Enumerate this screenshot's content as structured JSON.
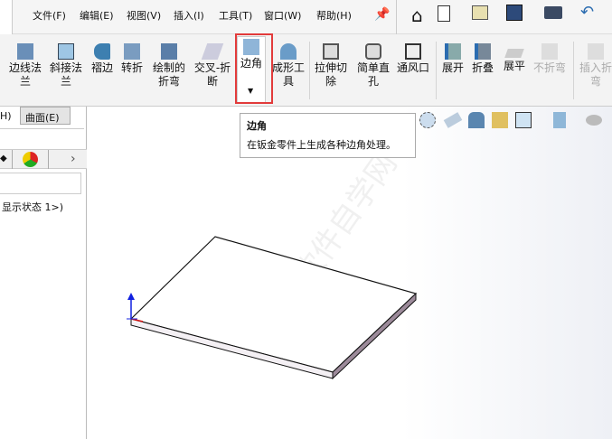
{
  "menu": [
    "文件(F)",
    "编辑(E)",
    "视图(V)",
    "插入(I)",
    "工具(T)",
    "窗口(W)",
    "帮助(H)"
  ],
  "ribbon": [
    {
      "label": "边线法\n兰",
      "enabled": true
    },
    {
      "label": "斜接法\n兰",
      "enabled": true
    },
    {
      "label": "褶边",
      "enabled": true
    },
    {
      "label": "转折",
      "enabled": true
    },
    {
      "label": "绘制的\n折弯",
      "enabled": true
    },
    {
      "label": "交叉-折\n断",
      "enabled": true
    },
    {
      "label": "边角",
      "enabled": true
    },
    {
      "label": "成形工\n具",
      "enabled": true
    },
    {
      "label": "拉伸切\n除",
      "enabled": true
    },
    {
      "label": "简单直\n孔",
      "enabled": true
    },
    {
      "label": "通风口",
      "enabled": true
    },
    {
      "label": "展开",
      "enabled": true
    },
    {
      "label": "折叠",
      "enabled": true
    },
    {
      "label": "展平",
      "enabled": true
    },
    {
      "label": "不折弯",
      "enabled": false
    },
    {
      "label": "插入折\n弯",
      "enabled": false
    }
  ],
  "tabs": {
    "partial": "H)",
    "surface": "曲面(E)"
  },
  "tree": {
    "display_state": "显示状态 1>)"
  },
  "tooltip": {
    "title": "边角",
    "desc": "在钣金零件上生成各种边角处理。"
  },
  "colors": {
    "highlight": "#e23b3b",
    "accent": "#2b6cb0"
  }
}
